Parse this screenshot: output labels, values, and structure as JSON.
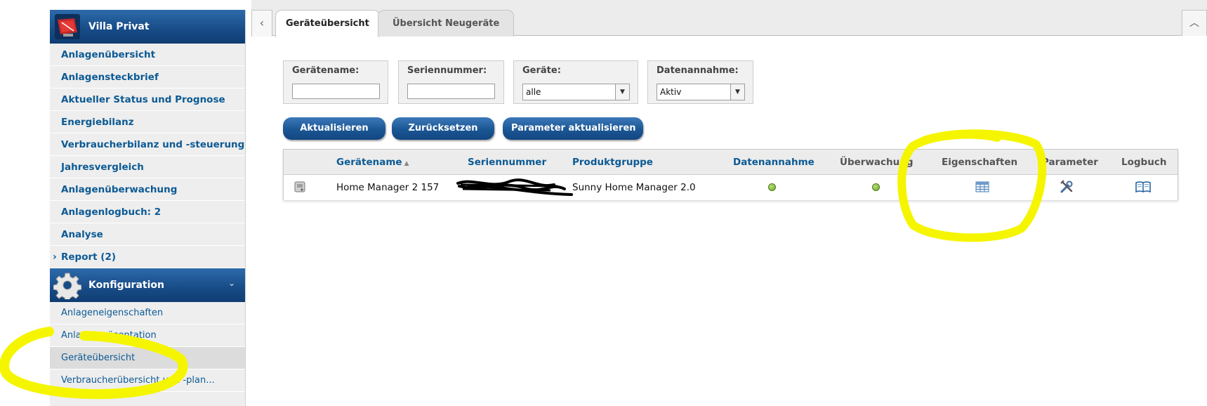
{
  "sidebar": {
    "site_title": "Villa Privat",
    "nav_items": [
      {
        "label": "Anlagenübersicht"
      },
      {
        "label": "Anlagensteckbrief"
      },
      {
        "label": "Aktueller Status und Prognose"
      },
      {
        "label": "Energiebilanz"
      },
      {
        "label": "Verbraucherbilanz und -steuerung"
      },
      {
        "label": "Jahresvergleich"
      },
      {
        "label": "Anlagenüberwachung"
      },
      {
        "label": "Anlagenlogbuch: 2"
      },
      {
        "label": "Analyse"
      },
      {
        "label": "Report (2)",
        "expand_icon": "›"
      }
    ],
    "config_section": {
      "title": "Konfiguration",
      "chevron": "⌄",
      "items": [
        {
          "label": "Anlageneigenschaften"
        },
        {
          "label": "Anlagenpräsentation"
        },
        {
          "label": "Geräteübersicht",
          "active": true
        },
        {
          "label": "Verbraucherübersicht und -plan..."
        }
      ]
    }
  },
  "tabs": {
    "back_icon": "‹",
    "items": [
      {
        "label": "Geräteübersicht",
        "active": true
      },
      {
        "label": "Übersicht Neugeräte",
        "active": false
      }
    ],
    "collapse_icon": "︿"
  },
  "filters": {
    "device_name": {
      "label": "Gerätename:",
      "value": ""
    },
    "serial_number": {
      "label": "Seriennummer:",
      "value": ""
    },
    "devices": {
      "label": "Geräte:",
      "selected": "alle"
    },
    "data_acceptance": {
      "label": "Datenannahme:",
      "selected": "Aktiv"
    }
  },
  "buttons": {
    "refresh": "Aktualisieren",
    "reset": "Zurücksetzen",
    "update_params": "Parameter aktualisieren"
  },
  "table": {
    "columns": {
      "name": "Gerätename",
      "serial": "Seriennummer",
      "product_group": "Produktgruppe",
      "data_acceptance": "Datenannahme",
      "monitoring": "Überwachung",
      "properties": "Eigenschaften",
      "parameters": "Parameter",
      "logbook": "Logbuch"
    },
    "sort_indicator": "▲",
    "rows": [
      {
        "device_icon": "device-icon",
        "name": "Home Manager 2 157",
        "serial": "",
        "product_group": "Sunny Home Manager 2.0",
        "data_acceptance_status": "green",
        "monitoring_status": "green",
        "properties_icon": "table-icon",
        "parameters_icon": "tools-icon",
        "logbook_icon": "book-icon"
      }
    ]
  },
  "colors": {
    "link_blue": "#0c5a94",
    "header_blue": "#174b86",
    "status_green": "#6aa62a",
    "highlight_yellow": "#f5f500"
  }
}
